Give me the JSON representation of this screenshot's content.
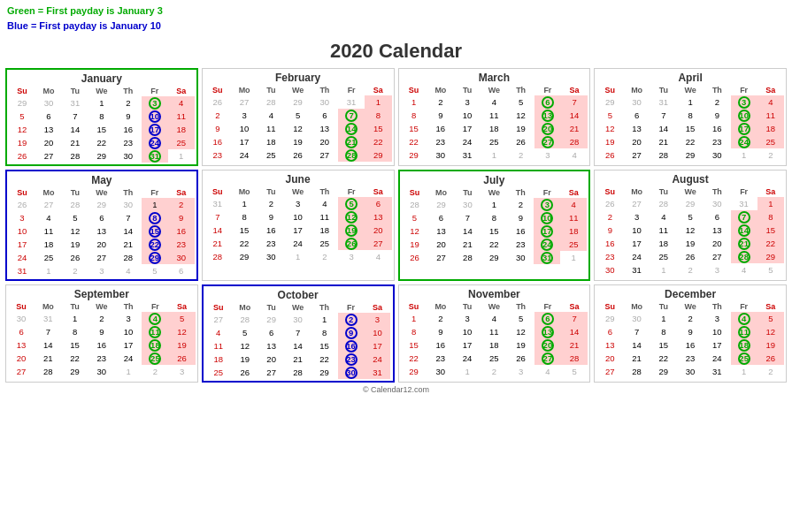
{
  "legend": {
    "green_text": "Green = First payday is January 3",
    "blue_text": "Blue = First payday is January 10"
  },
  "title": "2020 Calendar",
  "copyright": "© Calendar12.com",
  "months": [
    {
      "name": "January",
      "border": "green",
      "weeks": [
        [
          "29",
          "30",
          "31",
          "1",
          "2",
          "3",
          "4"
        ],
        [
          "5",
          "6",
          "7",
          "8",
          "9",
          "10",
          "11"
        ],
        [
          "12",
          "13",
          "14",
          "15",
          "16",
          "17",
          "18"
        ],
        [
          "19",
          "20",
          "21",
          "22",
          "23",
          "24",
          "25"
        ],
        [
          "26",
          "27",
          "28",
          "29",
          "30",
          "31",
          "1"
        ]
      ],
      "other_month": [
        "29",
        "30",
        "31"
      ],
      "other_month_end": [
        "1"
      ],
      "green_circles": [
        "3",
        "31"
      ],
      "blue_circles": [
        "10",
        "17",
        "24"
      ],
      "pink_cols": [
        4,
        5
      ]
    },
    {
      "name": "February",
      "border": "none",
      "weeks": [
        [
          "26",
          "27",
          "28",
          "29",
          "30",
          "31",
          "1"
        ],
        [
          "2",
          "3",
          "4",
          "5",
          "6",
          "7",
          "8"
        ],
        [
          "9",
          "10",
          "11",
          "12",
          "13",
          "14",
          "15"
        ],
        [
          "16",
          "17",
          "18",
          "19",
          "20",
          "21",
          "22"
        ],
        [
          "23",
          "24",
          "25",
          "26",
          "27",
          "28",
          "29"
        ]
      ],
      "green_circles": [
        "7",
        "14",
        "21",
        "28"
      ],
      "blue_circles": [],
      "pink_cols": [
        4,
        5
      ]
    },
    {
      "name": "March",
      "border": "none",
      "weeks": [
        [
          "1",
          "2",
          "3",
          "4",
          "5",
          "6",
          "7"
        ],
        [
          "8",
          "9",
          "10",
          "11",
          "12",
          "13",
          "14"
        ],
        [
          "15",
          "16",
          "17",
          "18",
          "19",
          "20",
          "21"
        ],
        [
          "22",
          "23",
          "24",
          "25",
          "26",
          "27",
          "28"
        ],
        [
          "29",
          "30",
          "31",
          "1",
          "2",
          "3",
          "4"
        ]
      ],
      "green_circles": [
        "6",
        "13",
        "20",
        "27"
      ],
      "blue_circles": [],
      "pink_cols": [
        4,
        5
      ]
    },
    {
      "name": "April",
      "border": "none",
      "weeks": [
        [
          "29",
          "30",
          "31",
          "1",
          "2",
          "3",
          "4"
        ],
        [
          "5",
          "6",
          "7",
          "8",
          "9",
          "10",
          "11"
        ],
        [
          "12",
          "13",
          "14",
          "15",
          "16",
          "17",
          "18"
        ],
        [
          "19",
          "20",
          "21",
          "22",
          "23",
          "24",
          "25"
        ],
        [
          "26",
          "27",
          "28",
          "29",
          "30",
          "1",
          "2"
        ]
      ],
      "green_circles": [
        "3",
        "10",
        "17",
        "24"
      ],
      "blue_circles": [],
      "pink_cols": [
        4,
        5
      ]
    },
    {
      "name": "May",
      "border": "blue",
      "weeks": [
        [
          "26",
          "27",
          "28",
          "29",
          "30",
          "1",
          "2"
        ],
        [
          "3",
          "4",
          "5",
          "6",
          "7",
          "8",
          "9"
        ],
        [
          "10",
          "11",
          "12",
          "13",
          "14",
          "15",
          "16"
        ],
        [
          "17",
          "18",
          "19",
          "20",
          "21",
          "22",
          "23"
        ],
        [
          "24",
          "25",
          "26",
          "27",
          "28",
          "29",
          "30"
        ],
        [
          "31",
          "1",
          "2",
          "3",
          "4",
          "5",
          "6"
        ]
      ],
      "green_circles": [
        "8",
        "15",
        "22",
        "29"
      ],
      "blue_circles": [],
      "pink_cols": [
        4,
        5
      ]
    },
    {
      "name": "June",
      "border": "none",
      "weeks": [
        [
          "31",
          "1",
          "2",
          "3",
          "4",
          "5",
          "6"
        ],
        [
          "7",
          "8",
          "9",
          "10",
          "11",
          "12",
          "13"
        ],
        [
          "14",
          "15",
          "16",
          "17",
          "18",
          "19",
          "20"
        ],
        [
          "21",
          "22",
          "23",
          "24",
          "25",
          "26",
          "27"
        ],
        [
          "28",
          "29",
          "30",
          "1",
          "2",
          "3",
          "4"
        ]
      ],
      "green_circles": [
        "5",
        "19",
        "26"
      ],
      "blue_circles": [],
      "pink_cols": [
        4,
        5
      ]
    },
    {
      "name": "July",
      "border": "green",
      "weeks": [
        [
          "28",
          "29",
          "30",
          "1",
          "2",
          "3",
          "4"
        ],
        [
          "5",
          "6",
          "7",
          "8",
          "9",
          "10",
          "11"
        ],
        [
          "12",
          "13",
          "14",
          "15",
          "16",
          "17",
          "18"
        ],
        [
          "19",
          "20",
          "21",
          "22",
          "23",
          "24",
          "25"
        ],
        [
          "26",
          "27",
          "28",
          "29",
          "30",
          "31",
          "1"
        ]
      ],
      "green_circles": [
        "3",
        "10",
        "17",
        "24",
        "31"
      ],
      "blue_circles": [],
      "pink_cols": [
        4,
        5
      ]
    },
    {
      "name": "August",
      "border": "none",
      "weeks": [
        [
          "26",
          "27",
          "28",
          "29",
          "30",
          "31",
          "1"
        ],
        [
          "2",
          "3",
          "4",
          "5",
          "6",
          "7",
          "8"
        ],
        [
          "9",
          "10",
          "11",
          "12",
          "13",
          "14",
          "15"
        ],
        [
          "16",
          "17",
          "18",
          "19",
          "20",
          "21",
          "22"
        ],
        [
          "23",
          "24",
          "25",
          "26",
          "27",
          "28",
          "29"
        ],
        [
          "30",
          "31",
          "1",
          "2",
          "3",
          "4",
          "5"
        ]
      ],
      "green_circles": [
        "7",
        "14",
        "21",
        "28"
      ],
      "blue_circles": [],
      "pink_cols": [
        4,
        5
      ]
    },
    {
      "name": "September",
      "border": "none",
      "weeks": [
        [
          "30",
          "31",
          "1",
          "2",
          "3",
          "4",
          "5"
        ],
        [
          "6",
          "7",
          "8",
          "9",
          "10",
          "11",
          "12"
        ],
        [
          "13",
          "14",
          "15",
          "16",
          "17",
          "18",
          "19"
        ],
        [
          "20",
          "21",
          "22",
          "23",
          "24",
          "25",
          "26"
        ],
        [
          "27",
          "28",
          "29",
          "30",
          "1",
          "2",
          "3"
        ]
      ],
      "green_circles": [
        "4",
        "11",
        "18",
        "25"
      ],
      "blue_circles": [],
      "pink_cols": [
        4,
        5
      ]
    },
    {
      "name": "October",
      "border": "blue",
      "weeks": [
        [
          "27",
          "28",
          "29",
          "30",
          "1",
          "2",
          "3"
        ],
        [
          "4",
          "5",
          "6",
          "7",
          "8",
          "9",
          "10"
        ],
        [
          "11",
          "12",
          "13",
          "14",
          "15",
          "16",
          "17"
        ],
        [
          "18",
          "19",
          "20",
          "21",
          "22",
          "23",
          "24"
        ],
        [
          "25",
          "26",
          "27",
          "28",
          "29",
          "30",
          "31"
        ]
      ],
      "green_circles": [
        "2",
        "9",
        "16",
        "23",
        "30"
      ],
      "blue_circles": [],
      "pink_cols": [
        4,
        5
      ]
    },
    {
      "name": "November",
      "border": "none",
      "weeks": [
        [
          "1",
          "2",
          "3",
          "4",
          "5",
          "6",
          "7"
        ],
        [
          "8",
          "9",
          "10",
          "11",
          "12",
          "13",
          "14"
        ],
        [
          "15",
          "16",
          "17",
          "18",
          "19",
          "20",
          "21"
        ],
        [
          "22",
          "23",
          "24",
          "25",
          "26",
          "27",
          "28"
        ],
        [
          "29",
          "30",
          "1",
          "2",
          "3",
          "4",
          "5"
        ]
      ],
      "green_circles": [
        "6",
        "13",
        "20",
        "27"
      ],
      "blue_circles": [],
      "pink_cols": [
        4,
        5
      ]
    },
    {
      "name": "December",
      "border": "none",
      "weeks": [
        [
          "29",
          "30",
          "1",
          "2",
          "3",
          "4",
          "5"
        ],
        [
          "6",
          "7",
          "8",
          "9",
          "10",
          "11",
          "12"
        ],
        [
          "13",
          "14",
          "15",
          "16",
          "17",
          "18",
          "19"
        ],
        [
          "20",
          "21",
          "22",
          "23",
          "24",
          "25",
          "26"
        ],
        [
          "27",
          "28",
          "29",
          "30",
          "31",
          "1",
          "2"
        ]
      ],
      "green_circles": [
        "4",
        "11",
        "18",
        "25"
      ],
      "blue_circles": [],
      "pink_cols": [
        4,
        5
      ]
    }
  ]
}
